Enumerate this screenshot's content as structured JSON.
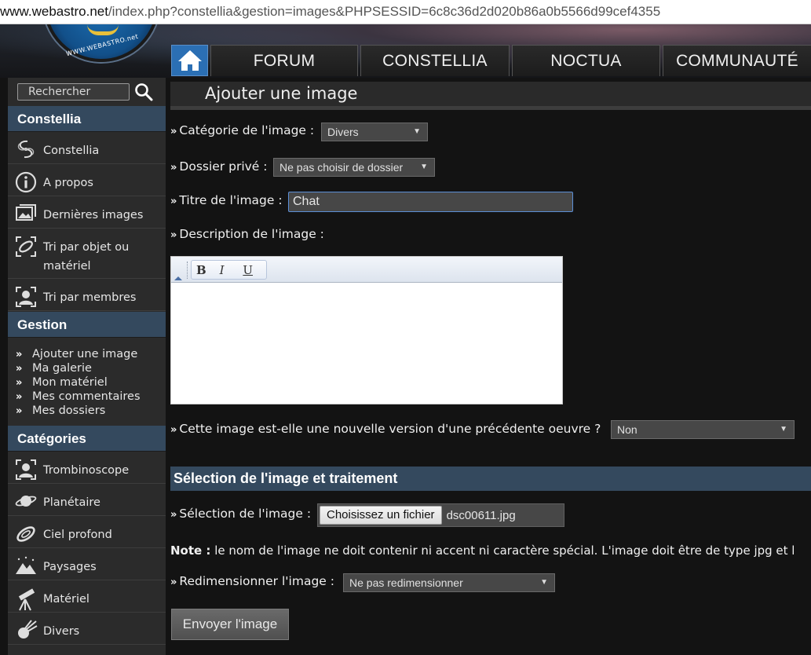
{
  "browser": {
    "url_host": "www.webastro.net",
    "url_rest": "/index.php?constellia&gestion=images&PHPSESSID=6c8c36d2d020b86a0b5566d99cef4355"
  },
  "logo": {
    "text": "WWW.WEBASTRO.net"
  },
  "topnav": {
    "home_icon": "home-icon",
    "tabs": [
      "FORUM",
      "CONSTELLIA",
      "NOCTUA",
      "COMMUNAUTÉ"
    ]
  },
  "sidebar": {
    "search_placeholder": "Rechercher",
    "sections": [
      {
        "title": "Constellia"
      },
      {
        "title": "Gestion"
      },
      {
        "title": "Catégories"
      }
    ],
    "constellia_items": [
      {
        "label": "Constellia",
        "icon": "galaxy-icon"
      },
      {
        "label": "A propos",
        "icon": "info-icon"
      },
      {
        "label": "Dernières images",
        "icon": "images-icon"
      },
      {
        "label_line1": "Tri par objet ou",
        "label_line2": "matériel",
        "icon": "object-icon"
      },
      {
        "label": "Tri par membres",
        "icon": "members-icon"
      }
    ],
    "gestion_items": [
      "Ajouter une image",
      "Ma galerie",
      "Mon matériel",
      "Mes commentaires",
      "Mes dossiers"
    ],
    "categories": [
      {
        "label": "Trombinoscope",
        "icon": "portrait-icon"
      },
      {
        "label": "Planétaire",
        "icon": "planet-icon"
      },
      {
        "label": "Ciel profond",
        "icon": "deep-sky-icon"
      },
      {
        "label": "Paysages",
        "icon": "landscape-icon"
      },
      {
        "label": "Matériel",
        "icon": "telescope-icon"
      },
      {
        "label": "Divers",
        "icon": "comet-icon"
      }
    ]
  },
  "main": {
    "page_title": "Ajouter une image",
    "category_label": "Catégorie de l'image :",
    "category_value": "Divers",
    "folder_label": "Dossier privé :",
    "folder_value": "Ne pas choisir de dossier",
    "title_label": "Titre de l'image :",
    "title_value": "Chat",
    "description_label": "Description de l'image :",
    "editor_buttons": [
      "B",
      "I",
      "U"
    ],
    "version_label": "Cette image est-elle une nouvelle version d'une précédente oeuvre ?",
    "version_value": "Non",
    "section_title": "Sélection de l'image et traitement",
    "file_label": "Sélection de l'image :",
    "file_button": "Choisissez un fichier",
    "file_name": "dsc00611.jpg",
    "note_bold": "Note :",
    "note_text": " le nom de l'image ne doit contenir ni accent ni caractère spécial. L'image doit être de type jpg et l",
    "resize_label": "Redimensionner l'image :",
    "resize_value": "Ne pas redimensionner",
    "submit_label": "Envoyer l'image"
  }
}
